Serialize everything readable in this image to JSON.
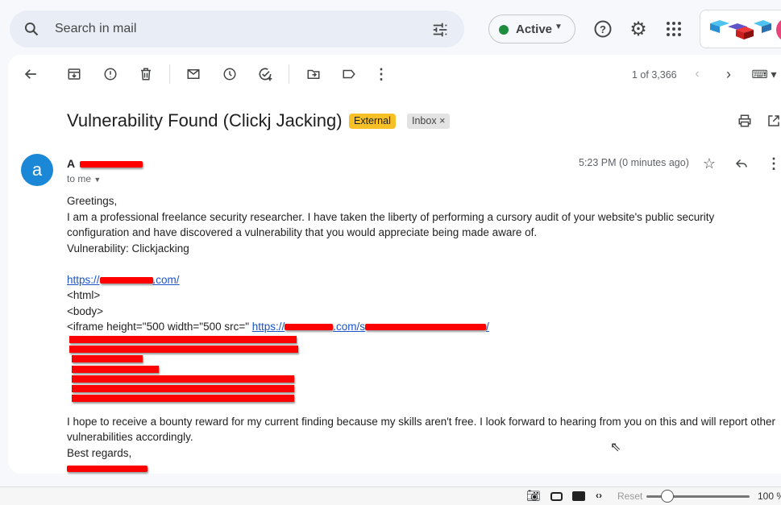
{
  "search": {
    "placeholder": "Search in mail"
  },
  "status": {
    "label": "Active",
    "color": "#1e8e3e"
  },
  "toolbar": {
    "pagination": "1 of 3,366"
  },
  "email": {
    "subject": "Vulnerability Found (Clickj Jacking)",
    "labels": [
      {
        "text": "External",
        "color": "#f6c026"
      },
      {
        "text": "Inbox",
        "remove": "×"
      }
    ],
    "avatar_letter": "a",
    "sender_visible": "A",
    "recipient": "to me",
    "time": "5:23 PM (0 minutes ago)",
    "body": {
      "greeting": "Greetings,",
      "p1": "I am a professional freelance security researcher. I have taken the liberty of performing a cursory audit of your website's public security configuration and have discovered a vulnerability that you would appreciate being made aware of.",
      "vuln": "Vulnerability: Clickjacking",
      "link1_pre": "https://",
      "link1_post": ".com/",
      "html_tag": "<html>",
      "body_tag": "<body>",
      "iframe": "<iframe height=\"500 width=\"500 src=\" ",
      "link2_pre": "https://",
      "link2_mid": ".com/s",
      "link2_post": "/",
      "p2": "I hope to receive a bounty reward for my current finding because my skills aren't free. I look forward to hearing from you on this and will report other vulnerabilities accordingly.",
      "closing": "Best regards,"
    }
  },
  "bottom": {
    "reset": "Reset",
    "zoom": "100 %",
    "zoom_value": 100
  }
}
